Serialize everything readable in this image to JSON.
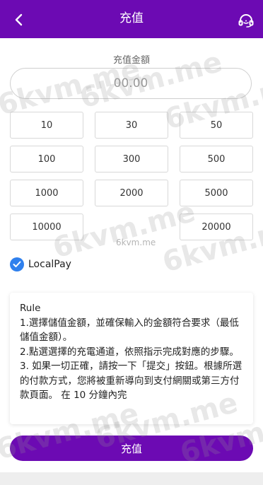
{
  "header": {
    "title": "充值",
    "bg_color": "#6c0ab3",
    "back_icon": "chevron-left-icon",
    "support_icon": "headset-icon"
  },
  "amount": {
    "label": "充值金額",
    "placeholder": "00.00"
  },
  "presets": [
    {
      "label": "10"
    },
    {
      "label": "30"
    },
    {
      "label": "50"
    },
    {
      "label": "100"
    },
    {
      "label": "300"
    },
    {
      "label": "500"
    },
    {
      "label": "1000"
    },
    {
      "label": "2000"
    },
    {
      "label": "5000"
    },
    {
      "label": "10000"
    },
    {
      "label": ""
    },
    {
      "label": "20000"
    }
  ],
  "payment": {
    "method": "LocalPay",
    "selected": true,
    "check_color": "#2f80ed"
  },
  "rules": {
    "title": "Rule",
    "lines": [
      "1.選擇儲值金額，並確保輸入的金額符合要求（最低儲值金額）。",
      "2.點選選擇的充電通道，依照指示完成對應的步驟。",
      "3. 如果一切正確，請按一下「提交」按鈕。根據所選的付款方式，您將被重新導向到支付網關或第三方付款頁面。 在 10 分鐘內完"
    ]
  },
  "submit": {
    "label": "充值"
  },
  "watermark": {
    "text": "6kvm.me",
    "small_text": "6kvm.me"
  }
}
